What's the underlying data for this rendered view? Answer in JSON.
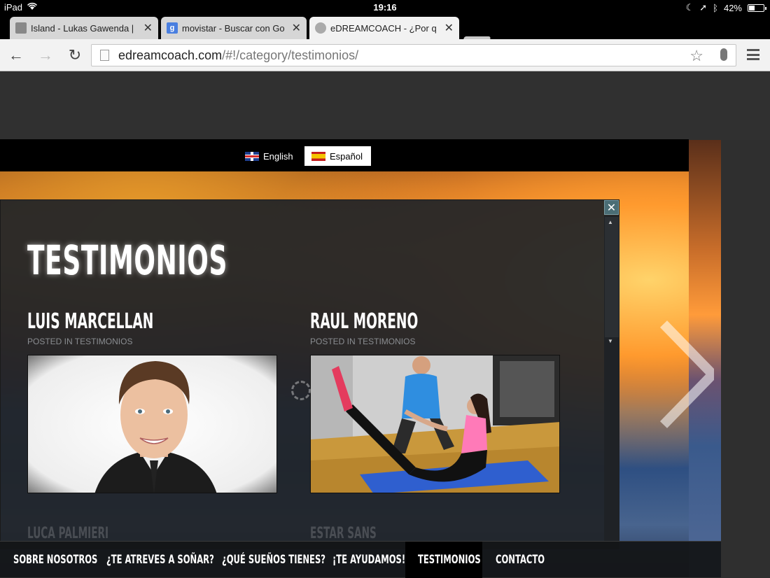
{
  "status_bar": {
    "device": "iPad",
    "time": "19:16",
    "battery": "42%",
    "battery_level": 0.42
  },
  "tabs": [
    {
      "title": "Island - Lukas Gawenda |",
      "favicon": "site-favicon",
      "active": false
    },
    {
      "title": "movistar - Buscar con Go",
      "favicon": "google-favicon",
      "favicon_text": "g",
      "active": false
    },
    {
      "title": "eDREAMCOACH - ¿Por q",
      "favicon": "globe-favicon",
      "active": true
    }
  ],
  "toolbar": {
    "url_host": "edreamcoach.com",
    "url_path": "/#!/category/testimonios/"
  },
  "languages": [
    {
      "label": "English",
      "flag": "uk-flag"
    },
    {
      "label": "Español",
      "flag": "spain-flag",
      "selected": true
    }
  ],
  "modal": {
    "close_glyph": "✕",
    "title": "TESTIMONIOS",
    "cards": [
      {
        "name": "LUIS MARCELLAN",
        "meta": "POSTED IN TESTIMONIOS"
      },
      {
        "name": "RAUL MORENO",
        "meta": "POSTED IN TESTIMONIOS"
      }
    ],
    "next_cards": [
      {
        "name": "LUCA PALMIERI"
      },
      {
        "name": "ESTAR SANS"
      }
    ]
  },
  "nav": [
    {
      "label": "SOBRE NOSOTROS"
    },
    {
      "label": "¿TE ATREVES A SOÑAR?"
    },
    {
      "label": "¿QUÉ SUEÑOS TIENES?"
    },
    {
      "label": "¡TE AYUDAMOS!"
    },
    {
      "label": "TESTIMONIOS",
      "active": true
    },
    {
      "label": "CONTACTO"
    }
  ],
  "colors": {
    "modal_bg": "#202428",
    "close_button": "#4a6d75",
    "nav_active": "#000000"
  }
}
